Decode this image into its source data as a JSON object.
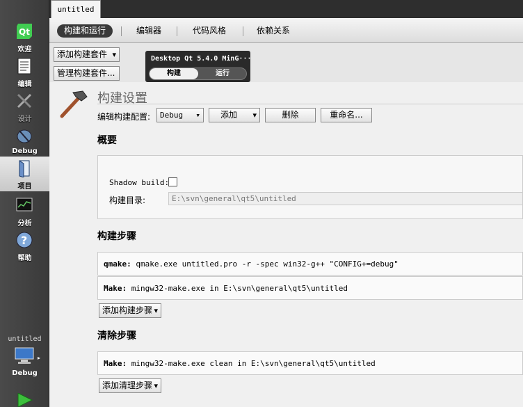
{
  "modebar": {
    "items": [
      {
        "label": "欢迎",
        "icon": "qt-logo-icon"
      },
      {
        "label": "编辑",
        "icon": "document-icon"
      },
      {
        "label": "设计",
        "icon": "design-tools-icon"
      },
      {
        "label": "Debug",
        "icon": "debug-bug-icon"
      },
      {
        "label": "项目",
        "icon": "project-folder-icon"
      },
      {
        "label": "分析",
        "icon": "analyze-monitor-icon"
      },
      {
        "label": "帮助",
        "icon": "help-icon"
      }
    ],
    "target": {
      "project": "untitled",
      "config": "Debug",
      "icon": "computer-icon"
    },
    "run_icon": "run-play-icon"
  },
  "doc_tab": "untitled",
  "subtabs": [
    "构建和运行",
    "编辑器",
    "代码风格",
    "依赖关系"
  ],
  "kit": {
    "add_kit": "添加构建套件",
    "manage_kits": "管理构建套件...",
    "name": "Desktop Qt 5.4.0 MinG···",
    "build": "构建",
    "run": "运行"
  },
  "build_settings": {
    "title": "构建设置",
    "icon": "hammer-icon",
    "edit_config_label": "编辑构建配置:",
    "config_value": "Debug",
    "add": "添加",
    "delete": "删除",
    "rename": "重命名..."
  },
  "general": {
    "heading": "概要",
    "shadow_label": "Shadow build:",
    "builddir_label": "构建目录:",
    "builddir_value": "E:\\svn\\general\\qt5\\untitled"
  },
  "build_steps": {
    "heading": "构建步骤",
    "qmake_name": "qmake:",
    "qmake_cmd": "qmake.exe untitled.pro -r -spec win32-g++ \"CONFIG+=debug\"",
    "make_name": "Make:",
    "make_cmd": "mingw32-make.exe in E:\\svn\\general\\qt5\\untitled",
    "add_step": "添加构建步骤"
  },
  "clean_steps": {
    "heading": "清除步骤",
    "make_name": "Make:",
    "make_cmd": "mingw32-make.exe clean in E:\\svn\\general\\qt5\\untitled",
    "add_step": "添加清理步骤"
  },
  "colors": {
    "modebar": "#3f3f3f",
    "active_tab": "#3a3a3a"
  }
}
